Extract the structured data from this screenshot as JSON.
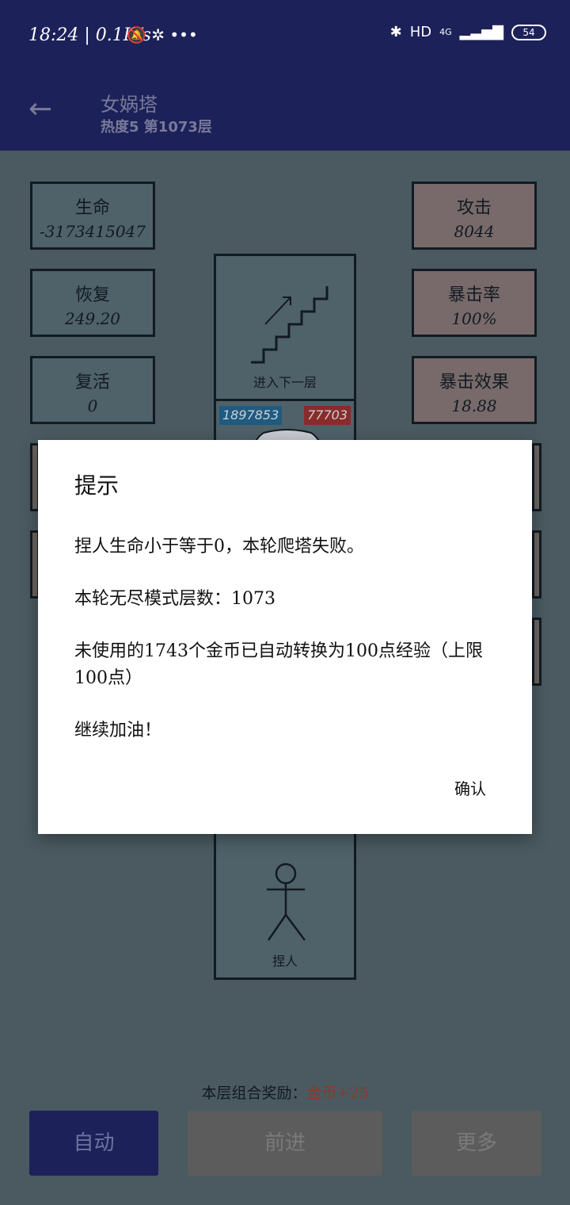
{
  "status_bar": {
    "time": "18:24 | 0.1K/s",
    "network": "4G",
    "hd": "HD",
    "battery": "54"
  },
  "app_bar": {
    "title": "女娲塔",
    "subtitle": "热度5 第1073层"
  },
  "left_stats": [
    {
      "label": "生命",
      "value": "-3173415047"
    },
    {
      "label": "恢复",
      "value": "249.20"
    },
    {
      "label": "复活",
      "value": "0"
    }
  ],
  "right_stats": [
    {
      "label": "攻击",
      "value": "8044"
    },
    {
      "label": "暴击率",
      "value": "100%"
    },
    {
      "label": "暴击效果",
      "value": "18.88"
    }
  ],
  "stairs_tile": {
    "caption": "进入下一层"
  },
  "enemy_tile": {
    "hp": "1897853",
    "atk": "77703"
  },
  "player_tile": {
    "caption": "捏人"
  },
  "dialog": {
    "title": "提示",
    "line1": "捏人生命小于等于0，本轮爬塔失败。",
    "line2": "本轮无尽模式层数：1073",
    "line3": "未使用的1743个金币已自动转换为100点经验（上限100点）",
    "line4": "继续加油！",
    "ok": "确认"
  },
  "reward": {
    "label": "本层组合奖励：",
    "value": "金币+25"
  },
  "buttons": {
    "auto": "自动",
    "forward": "前进",
    "more": "更多"
  },
  "colors": {
    "bar": "#1c2159",
    "background": "#4a5a60",
    "enemy_hp_badge": "#1f5a80",
    "enemy_atk_badge": "#8a2b2b"
  }
}
